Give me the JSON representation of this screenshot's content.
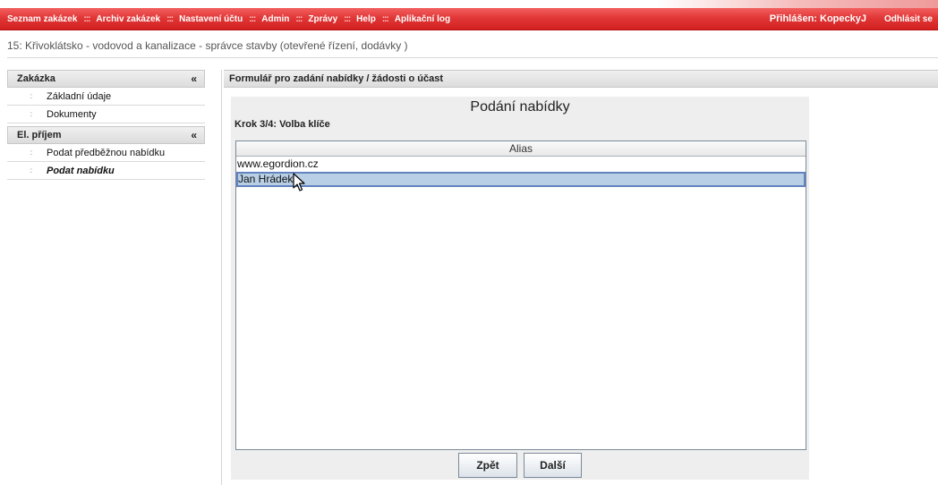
{
  "nav": {
    "items": [
      "Seznam zakázek",
      "Archiv zakázek",
      "Nastavení účtu",
      "Admin",
      "Zprávy",
      "Help",
      "Aplikační log"
    ],
    "separator": ":::",
    "user_label": "Přihlášen: KopeckyJ",
    "logout_label": "Odhlásit se"
  },
  "page": {
    "subtitle": "15: Křivoklátsko - vodovod a kanalizace - správce stavby (otevřené řízení, dodávky )"
  },
  "sidebar": {
    "sections": [
      {
        "title": "Zakázka",
        "items": [
          {
            "label": "Základní údaje"
          },
          {
            "label": "Dokumenty"
          }
        ]
      },
      {
        "title": "El. příjem",
        "items": [
          {
            "label": "Podat předběžnou nabídku"
          },
          {
            "label": "Podat nabídku"
          }
        ]
      }
    ]
  },
  "main": {
    "header": "Formulář pro zadání nabídky / žádosti o účast",
    "applet": {
      "title": "Podání nabídky",
      "step": "Krok 3/4: Volba klíče",
      "column_header": "Alias",
      "rows": [
        "www.egordion.cz",
        "Jan Hrádek"
      ],
      "selected_row": 1,
      "back_label": "Zpět",
      "next_label": "Další"
    }
  },
  "colors": {
    "nav_red": "#e13737",
    "selection_bg": "#b8cfe5",
    "selection_border": "#6382bf"
  }
}
